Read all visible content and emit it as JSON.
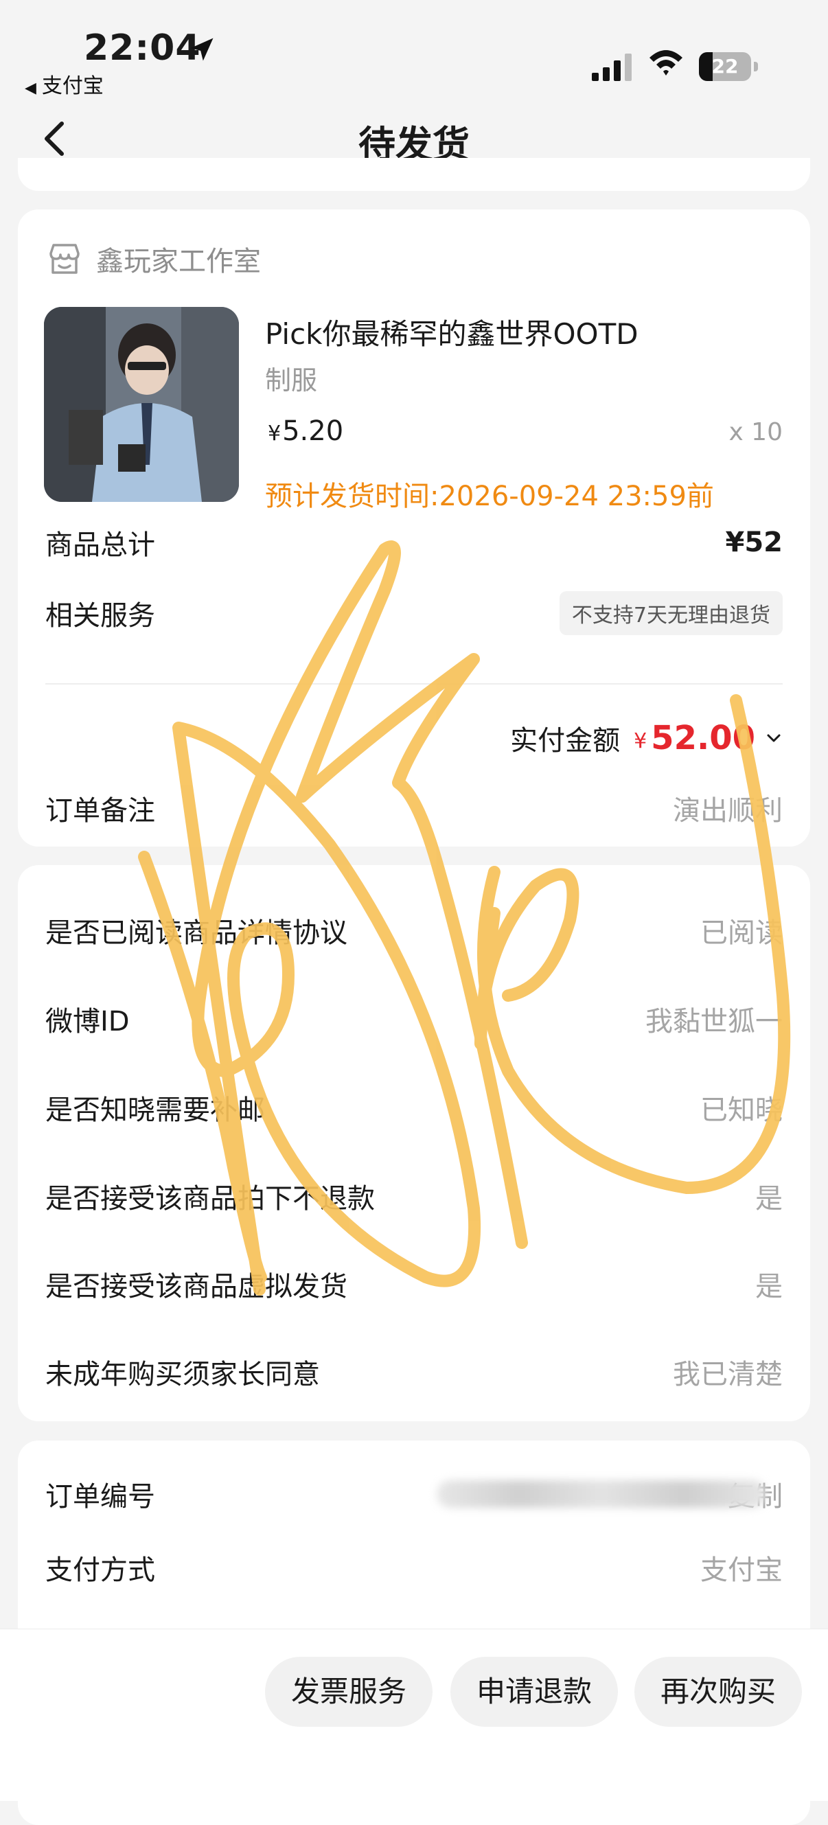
{
  "status_bar": {
    "time": "22:04",
    "back_app": "支付宝",
    "battery": "22"
  },
  "nav": {
    "title": "待发货"
  },
  "product_card": {
    "store_name": "鑫玩家工作室",
    "product_title": "Pick你最稀罕的鑫世界OOTD",
    "product_spec": "制服",
    "price_symbol": "¥",
    "price": "5.20",
    "quantity": "x 10",
    "ship_time": "预计发货时间:2026-09-24 23:59前",
    "subtotal_label": "商品总计",
    "subtotal_value": "¥52",
    "service_label": "相关服务",
    "service_tag": "不支持7天无理由退货",
    "paid_label": "实付金额",
    "paid_symbol": "¥",
    "paid_value": "52.00",
    "remark_label": "订单备注",
    "remark_value": "演出顺利"
  },
  "info_card": {
    "rows": [
      {
        "label": "是否已阅读商品详情协议",
        "value": "已阅读"
      },
      {
        "label": "微博ID",
        "value": "我黏世狐一"
      },
      {
        "label": "是否知晓需要补邮",
        "value": "已知晓"
      },
      {
        "label": "是否接受该商品拍下不退款",
        "value": "是"
      },
      {
        "label": "是否接受该商品虚拟发货",
        "value": "是"
      },
      {
        "label": "未成年购买须家长同意",
        "value": "我已清楚"
      }
    ]
  },
  "order_card": {
    "order_no_label": "订单编号",
    "copy_label": "复制",
    "pay_method_label": "支付方式",
    "pay_method_value": "支付宝"
  },
  "bottom_bar": {
    "invoice": "发票服务",
    "refund": "申请退款",
    "rebuy": "再次购买"
  },
  "colors": {
    "accent_orange": "#f08a12",
    "price_red": "#e5262d",
    "link_blue": "#3a78c8",
    "scribble": "#f7c25a"
  }
}
